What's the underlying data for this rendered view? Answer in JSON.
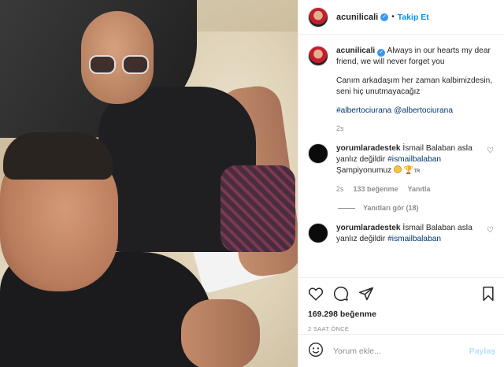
{
  "header": {
    "username": "acunilicali",
    "separator": "•",
    "follow_label": "Takip Et"
  },
  "caption": {
    "username": "acunilicali",
    "text_en": "Always in our hearts my dear friend, we will never forget you",
    "text_tr": "Canım arkadaşım her zaman kalbimizdesin, seni hiç unutmayacağız",
    "hashtag": "#albertociurana",
    "mention": "@albertociurana",
    "time": "2s"
  },
  "comments": [
    {
      "username": "yorumlaradestek",
      "text": "İsmail Balaban asla yanlız değildir",
      "tag": "#ismailbalaban",
      "extra": "Şampiyonumuz",
      "emoji_suffix": "TR",
      "time": "2s",
      "likes": "133 beğenme",
      "reply_label": "Yanıtla",
      "view_replies": "Yanıtları gör (18)"
    },
    {
      "username": "yorumlaradestek",
      "text": "İsmail Balaban asla yanlız değildir",
      "tag": "#ismailbalaban"
    }
  ],
  "actions": {
    "icons": [
      "heart-icon",
      "comment-icon",
      "share-icon",
      "bookmark-icon"
    ],
    "likes_count": "169.298 beğenme",
    "time_ago": "2 SAAT ÖNCE"
  },
  "add_comment": {
    "placeholder": "Yorum ekle...",
    "post_label": "Paylaş"
  },
  "colors": {
    "link": "#0095f6",
    "tag": "#00376b",
    "muted": "#8e8e8e",
    "verified": "#3897f0"
  }
}
